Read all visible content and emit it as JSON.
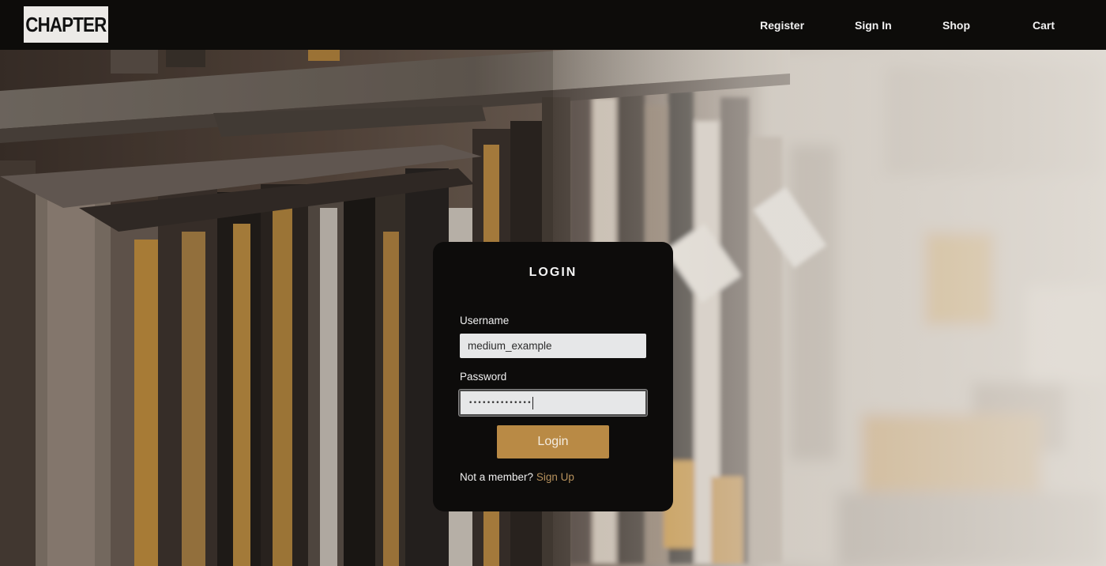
{
  "header": {
    "logo_text": "CHAPTER",
    "nav": [
      {
        "label": "Register"
      },
      {
        "label": "Sign In"
      },
      {
        "label": "Shop"
      },
      {
        "label": "Cart"
      }
    ]
  },
  "login": {
    "title": "LOGIN",
    "username_label": "Username",
    "username_value": "medium_example",
    "password_label": "Password",
    "password_value": "••••••••••••••",
    "submit_label": "Login",
    "member_prompt": "Not a member?",
    "signup_label": "Sign Up"
  },
  "colors": {
    "header_bg": "#0d0c0a",
    "card_bg": "#0d0c0b",
    "accent": "#b98a45",
    "link": "#b6915c",
    "input_bg": "#e6e7e8"
  }
}
